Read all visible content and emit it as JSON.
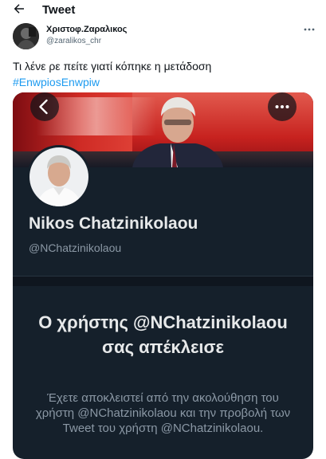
{
  "header": {
    "title": "Tweet"
  },
  "tweet": {
    "author_name": "Χριστοφ.Ζαραλικος",
    "author_handle": "@zaralikos_chr",
    "text": "Τι λένε ρε πείτε γιατί κόπηκε η μετάδοση",
    "hashtag": "#EnwpiosEnwpiw"
  },
  "card": {
    "profile_name": "Nikos Chatzinikolaou",
    "profile_handle": "@NChatzinikolaou",
    "blocked_title": "Ο χρήστης @NChatzinikolaou σας απέκλεισε",
    "blocked_body": "Έχετε αποκλειστεί από την ακολούθηση του χρήστη @NChatzinikolaou και την προβολή των Tweet του χρήστη @NChatzinikolaou."
  },
  "icons": {
    "back": "arrow-left-icon",
    "more": "more-horizontal-icon",
    "card_back": "chevron-left-icon",
    "card_more": "more-horizontal-icon"
  },
  "colors": {
    "link": "#1d9bf0",
    "card_background": "#15202b",
    "banner_red": "#c7221f"
  }
}
